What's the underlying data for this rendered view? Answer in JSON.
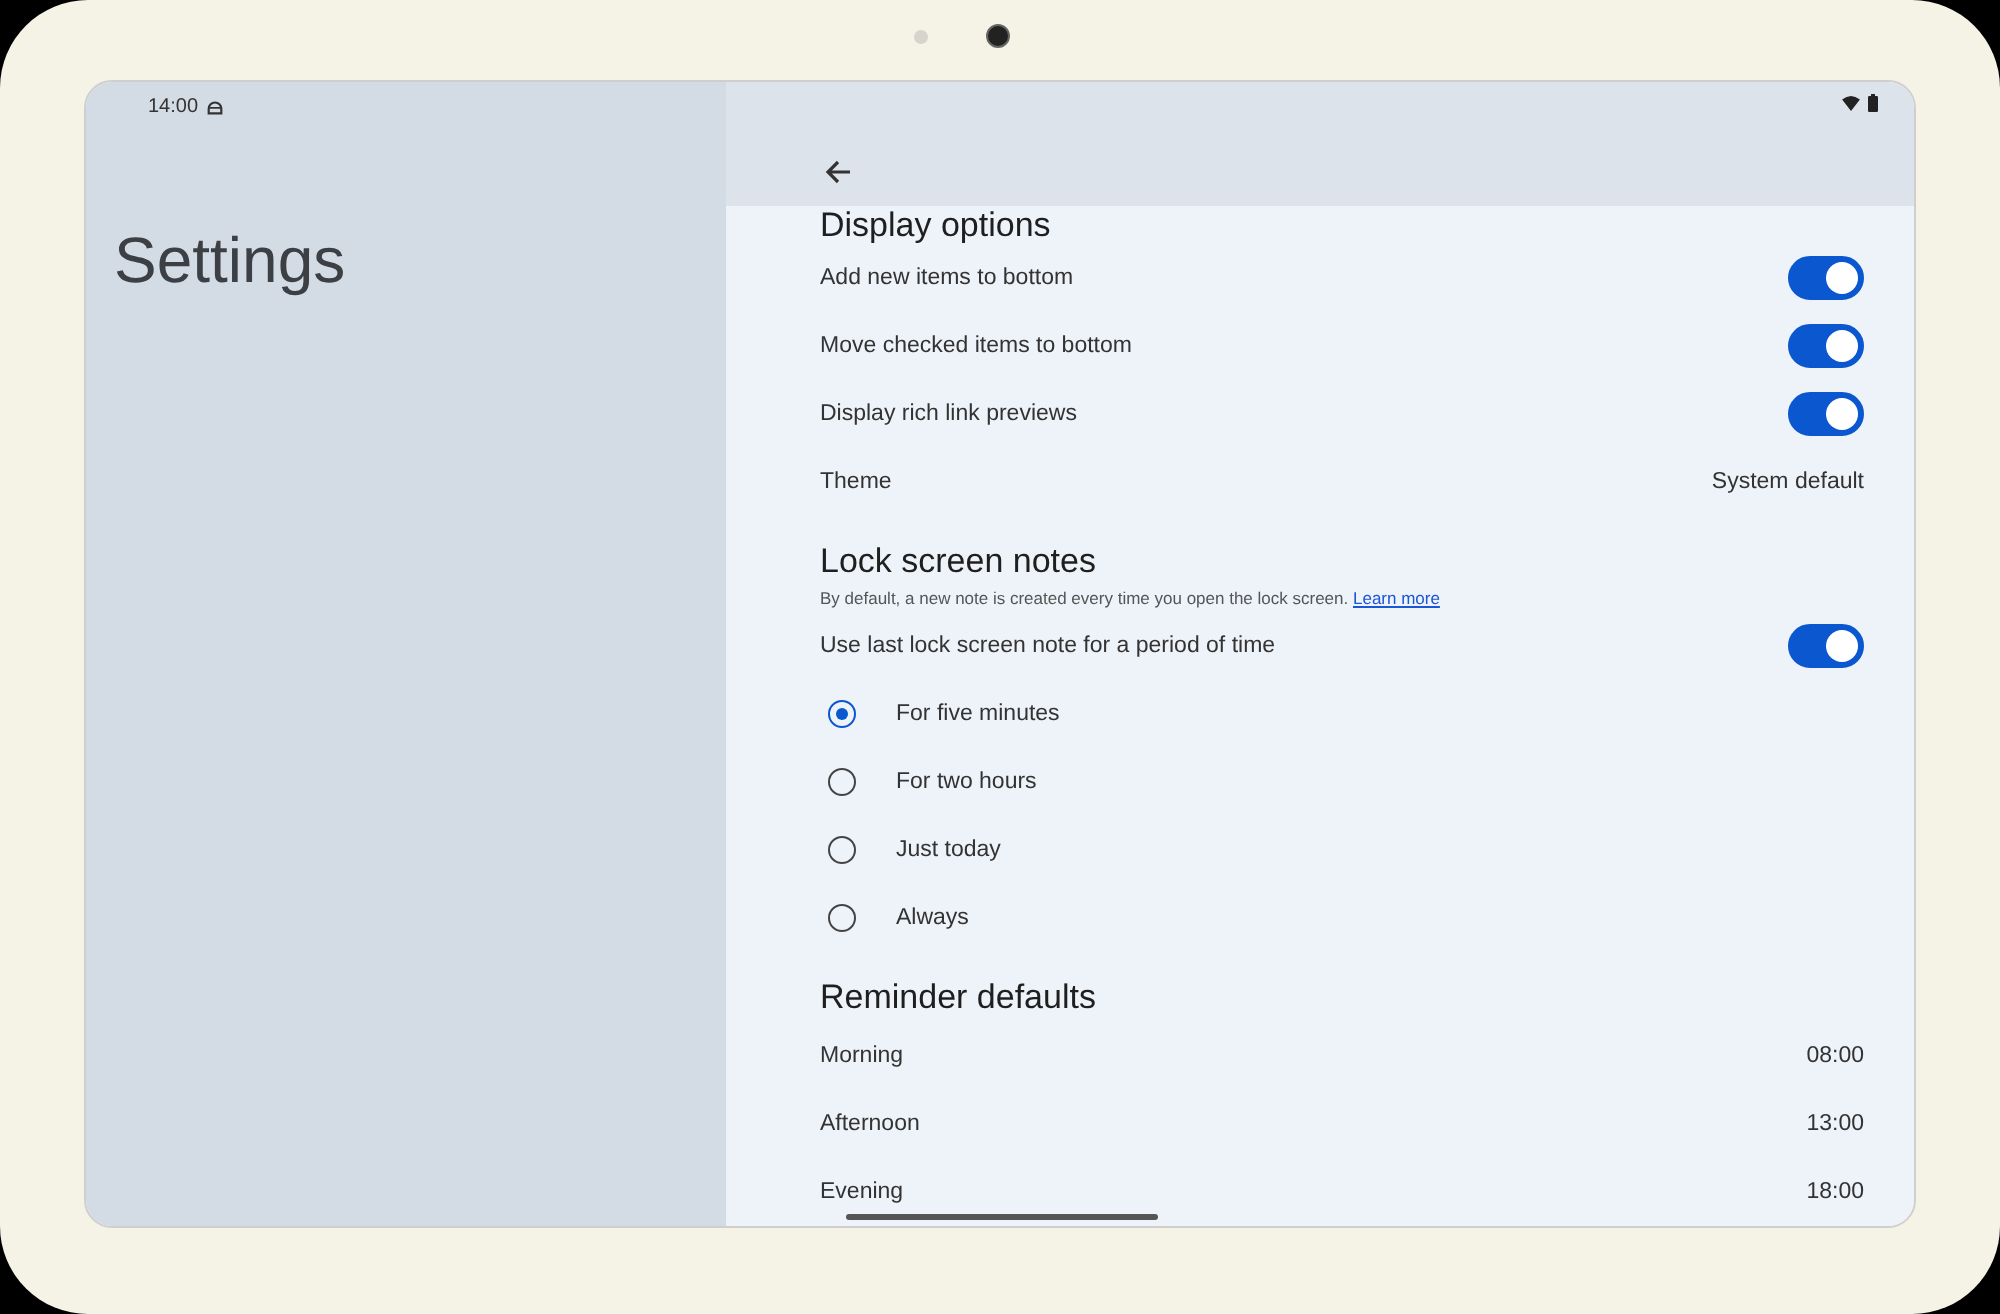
{
  "status_bar": {
    "time": "14:00"
  },
  "sidebar": {
    "title": "Settings"
  },
  "sections": [
    {
      "title": "Display options",
      "rows": [
        {
          "kind": "toggle",
          "label": "Add new items to bottom",
          "on": true
        },
        {
          "kind": "toggle",
          "label": "Move checked items to bottom",
          "on": true
        },
        {
          "kind": "toggle",
          "label": "Display rich link previews",
          "on": true
        },
        {
          "kind": "value",
          "label": "Theme",
          "value": "System default"
        }
      ]
    },
    {
      "title": "Lock screen notes",
      "description": "By default, a new note is created every time you open the lock screen.",
      "link": "Learn more",
      "rows": [
        {
          "kind": "toggle",
          "label": "Use last lock screen note for a period of time",
          "on": true
        },
        {
          "kind": "radio",
          "label": "For five minutes",
          "selected": true
        },
        {
          "kind": "radio",
          "label": "For two hours",
          "selected": false
        },
        {
          "kind": "radio",
          "label": "Just today",
          "selected": false
        },
        {
          "kind": "radio",
          "label": "Always",
          "selected": false
        }
      ]
    },
    {
      "title": "Reminder defaults",
      "rows": [
        {
          "kind": "value",
          "label": "Morning",
          "value": "08:00"
        },
        {
          "kind": "value",
          "label": "Afternoon",
          "value": "13:00"
        },
        {
          "kind": "value",
          "label": "Evening",
          "value": "18:00"
        }
      ]
    }
  ]
}
